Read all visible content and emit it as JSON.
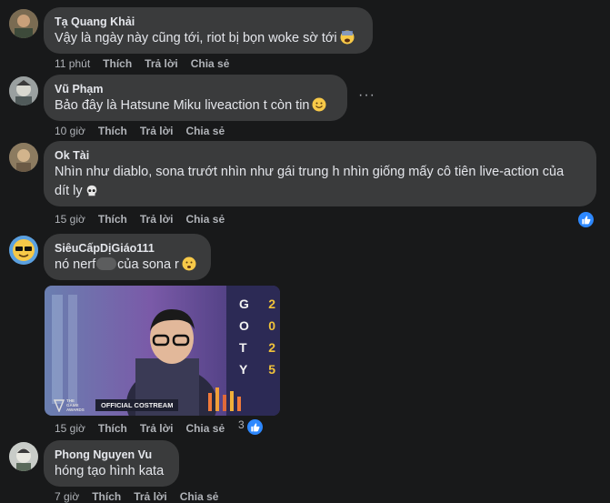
{
  "comments": [
    {
      "author": "Tạ Quang Khải",
      "text": "Vậy là ngày này cũng tới, riot bị bọn woke sờ tới",
      "emoji": "anxious-face-emoji",
      "time": "11 phút",
      "like": "Thích",
      "reply": "Trả lời",
      "share": "Chia sẻ"
    },
    {
      "author": "Vũ Phạm",
      "text": "Bảo đây là Hatsune Miku liveaction t còn tin",
      "emoji": "smiling-face-emoji",
      "time": "10 giờ",
      "like": "Thích",
      "reply": "Trả lời",
      "share": "Chia sẻ"
    },
    {
      "author": "Ok Tài",
      "text_line1": "Nhìn như diablo, sona trướt nhìn như gái trung h nhìn giống mấy cô tiên live-action của",
      "text_line2": "dít ly",
      "emoji": "skull-emoji",
      "time": "15 giờ",
      "like": "Thích",
      "reply": "Trả lời",
      "share": "Chia sẻ"
    },
    {
      "author": "SiêuCấpDịGiáo111",
      "text_pre": "nó nerf",
      "text_post": "của sona r",
      "emoji": "frowning-face-emoji",
      "time": "15 giờ",
      "like": "Thích",
      "reply": "Trả lời",
      "share": "Chia sẻ",
      "reaction_count": "3",
      "media": {
        "goty_letters": [
          "G",
          "O",
          "T",
          "Y"
        ],
        "goty_digits": [
          "2",
          "0",
          "2",
          "5"
        ],
        "brand_line1": "THE",
        "brand_line2": "GAME",
        "brand_line3": "AWARDS",
        "banner": "OFFICIAL COSTREAM"
      }
    },
    {
      "author": "Phong Nguyen Vu",
      "text": "hóng tạo hình kata",
      "time": "7 giờ",
      "like": "Thích",
      "reply": "Trả lời",
      "share": "Chia sẻ"
    }
  ],
  "colors": {
    "background": "#18191a",
    "bubble": "#3a3b3c",
    "like_blue": "#2d88ff",
    "goty_gold": "#f0c23a"
  }
}
